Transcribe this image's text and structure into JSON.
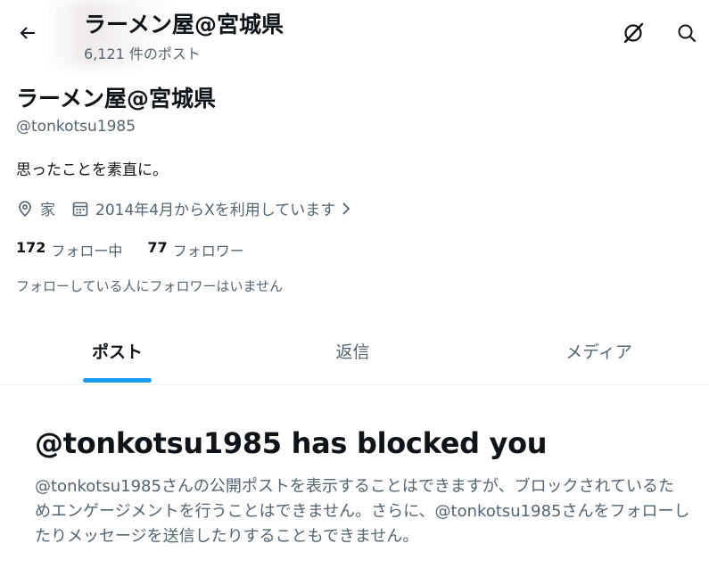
{
  "header": {
    "title": "ラーメン屋@宮城県",
    "post_count": "6,121 件のポスト",
    "back_icon": "arrow-left-icon",
    "grok_icon": "grok-icon",
    "search_icon": "search-icon"
  },
  "profile": {
    "display_name": "ラーメン屋@宮城県",
    "handle": "@tonkotsu1985",
    "bio": "思ったことを素直に。",
    "location": "家",
    "joined": "2014年4月からXを利用しています",
    "following_count": "172",
    "following_label": "フォロー中",
    "followers_count": "77",
    "followers_label": "フォロワー",
    "followers_note": "フォローしている人にフォロワーはいません"
  },
  "tabs": [
    {
      "label": "ポスト",
      "active": true
    },
    {
      "label": "返信",
      "active": false
    },
    {
      "label": "メディア",
      "active": false
    }
  ],
  "blocked": {
    "title": "@tonkotsu1985 has blocked you",
    "body": "@tonkotsu1985さんの公開ポストを表示することはできますが、ブロックされているためエンゲージメントを行うことはできません。さらに、@tonkotsu1985さんをフォローしたりメッセージを送信したりすることもできません。"
  },
  "colors": {
    "accent": "#1d9bf0",
    "text_primary": "#0f1419",
    "text_secondary": "#536471"
  }
}
